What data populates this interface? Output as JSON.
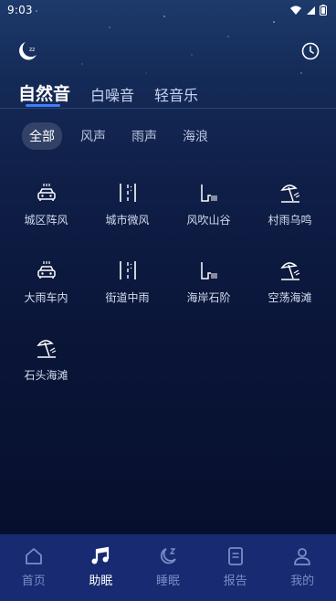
{
  "status_bar": {
    "time": "9:03"
  },
  "tabs": [
    {
      "label": "自然音",
      "active": true
    },
    {
      "label": "白噪音",
      "active": false
    },
    {
      "label": "轻音乐",
      "active": false
    }
  ],
  "filters": [
    {
      "label": "全部",
      "active": true
    },
    {
      "label": "风声",
      "active": false
    },
    {
      "label": "雨声",
      "active": false
    },
    {
      "label": "海浪",
      "active": false
    }
  ],
  "sounds": [
    {
      "label": "城区阵风",
      "icon": "car-icon"
    },
    {
      "label": "城市微风",
      "icon": "road-icon"
    },
    {
      "label": "风吹山谷",
      "icon": "valley-icon"
    },
    {
      "label": "村雨乌鸣",
      "icon": "beach-umbrella-icon"
    },
    {
      "label": "大雨车内",
      "icon": "car-icon"
    },
    {
      "label": "街道中雨",
      "icon": "road-icon"
    },
    {
      "label": "海岸石阶",
      "icon": "valley-icon"
    },
    {
      "label": "空荡海滩",
      "icon": "beach-umbrella-icon"
    },
    {
      "label": "石头海滩",
      "icon": "beach-umbrella-icon"
    }
  ],
  "bottom_nav": [
    {
      "label": "首页",
      "icon": "home-icon",
      "active": false
    },
    {
      "label": "助眠",
      "icon": "music-note-icon",
      "active": true
    },
    {
      "label": "睡眠",
      "icon": "moon-zzz-icon",
      "active": false
    },
    {
      "label": "报告",
      "icon": "report-icon",
      "active": false
    },
    {
      "label": "我的",
      "icon": "user-icon",
      "active": false
    }
  ],
  "colors": {
    "accent": "#3f7cff",
    "nav_bg": "#172a72",
    "nav_inactive": "#7d8cc4"
  }
}
